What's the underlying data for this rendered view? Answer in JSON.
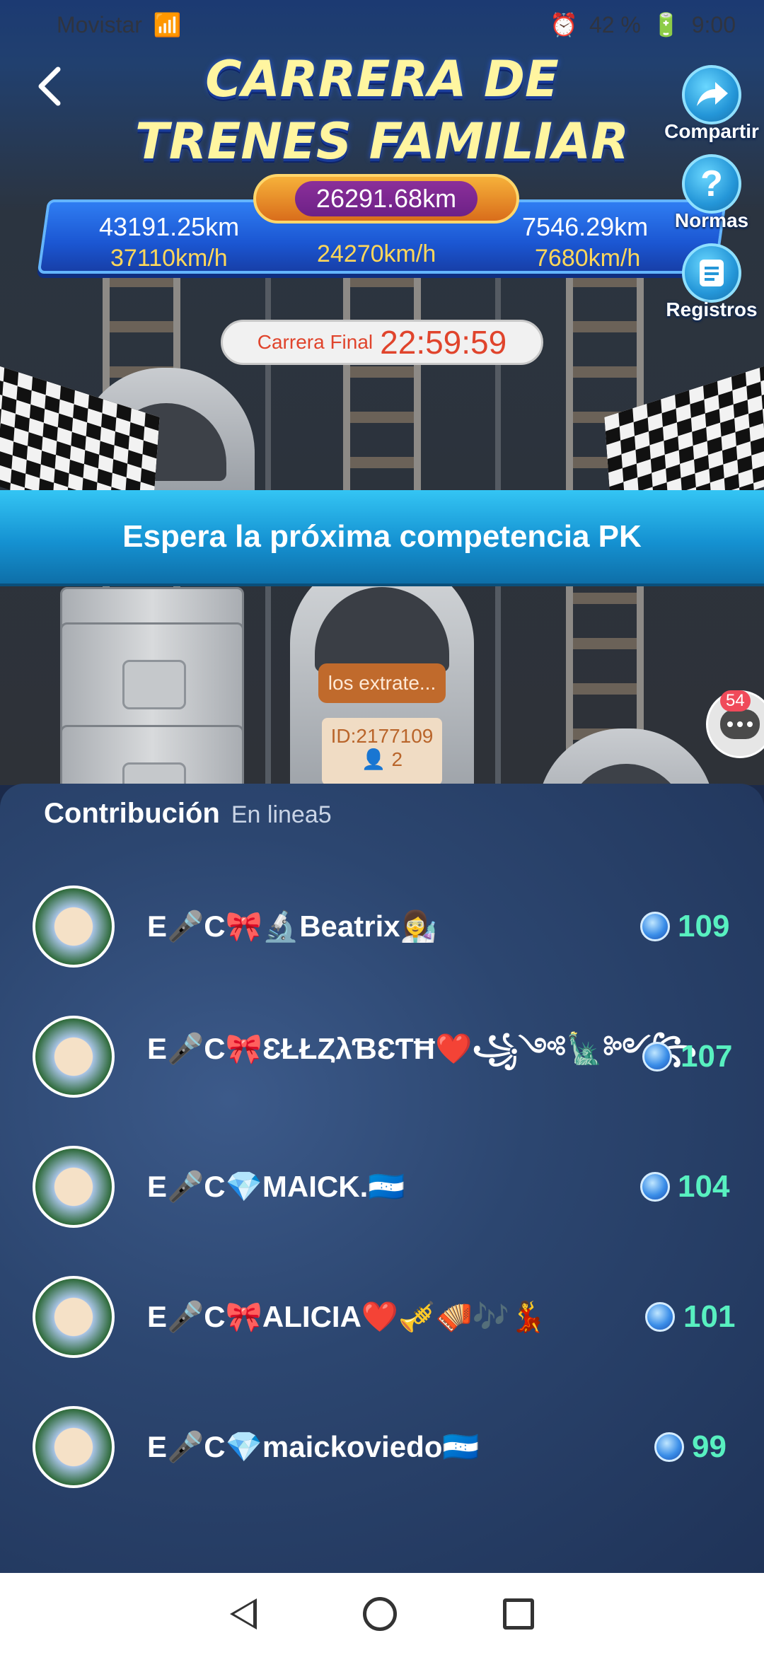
{
  "status_bar": {
    "carrier": "Movistar",
    "battery": "42 %",
    "time": "9:00"
  },
  "header": {
    "title_line1": "CARRERA DE",
    "title_line2": "TRENES FAMILIAR",
    "back_icon": "chevron-left-icon"
  },
  "race": {
    "total_distance": "26291.68km",
    "left_distance": "43191.25km",
    "left_speed": "37110km/h",
    "center_speed": "24270km/h",
    "right_distance": "7546.29km",
    "right_speed": "7680km/h",
    "timer_label": "Carrera Final",
    "timer_value": "22:59:59",
    "banner_text": "Espera la próxima competencia PK",
    "train_tag_name": "los extrate...",
    "train_tag_id": "ID:2177109",
    "train_tag_count": "2"
  },
  "side_buttons": [
    {
      "label": "Compartir",
      "icon": "share-arrow-icon"
    },
    {
      "label": "Normas",
      "icon": "question-icon"
    },
    {
      "label": "Registros",
      "icon": "records-icon"
    }
  ],
  "chat": {
    "badge": "54",
    "icon": "chat-icon"
  },
  "contribution": {
    "title": "Contribución",
    "subtitle": "En linea5",
    "rows": [
      {
        "name": "E🎤C🎀🔬Beatrix👩‍🔬",
        "score": "109"
      },
      {
        "name": "E🎤C🎀ƐŁŁȤλƁƐƬĦ❤️꧁༺🗽༻꧂",
        "score": "107"
      },
      {
        "name": "E🎤C💎MAICK.🇭🇳",
        "score": "104"
      },
      {
        "name": "E🎤C🎀ALICIA❤️🎺🪗🎶💃",
        "score": "101"
      },
      {
        "name": "E🎤C💎maickoviedo🇭🇳",
        "score": "99"
      }
    ]
  },
  "colors": {
    "title_yellow": "#fff5a0",
    "score_green": "#58f0c0",
    "timer_red": "#e0442c",
    "banner_blue": "#1592d2"
  }
}
